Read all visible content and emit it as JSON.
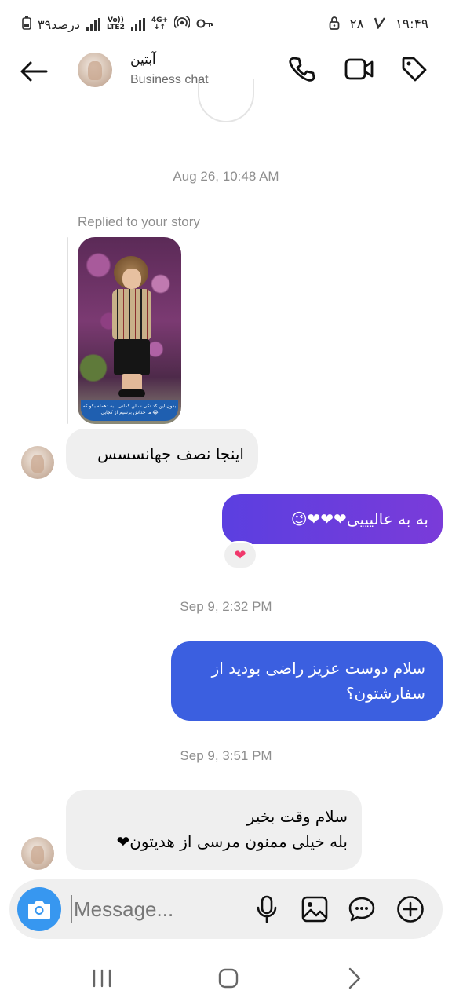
{
  "status_bar": {
    "time": "۱۹:۴۹",
    "battery_text": "۳۹درصد",
    "signal_icons": [
      "volte-icon",
      "4g-icon",
      "hotspot-icon",
      "vpn-key-icon"
    ],
    "right_number": "۲۸",
    "volte_label": "Vo)) LTE2",
    "net_label": "4G+"
  },
  "header": {
    "title": "آبتین",
    "subtitle": "Business chat",
    "icons": [
      "back-arrow-icon",
      "phone-icon",
      "video-camera-icon",
      "tag-icon"
    ]
  },
  "messages": {
    "timestamp_1": "Aug 26, 10:48 AM",
    "replied_label": "Replied to your story",
    "story_caption": "بدون این کد تکی سالن کمانی . به دهمله بکو که ما خداش برسیم از کجایی 😂",
    "reply_text": "اینجا نصف جهانسسس",
    "sent_1": "به به عالیییی❤❤❤😉",
    "reaction": "❤",
    "timestamp_2": "Sep 9, 2:32 PM",
    "sent_2_line1": "سلام دوست عزیز راضی بودید از",
    "sent_2_line2": "سفارشتون؟",
    "timestamp_3": "Sep 9, 3:51 PM",
    "received_2_line1": "سلام وقت بخیر",
    "received_2_line2": "بله خیلی ممنون مرسی از هدیتون❤"
  },
  "composer": {
    "placeholder": "Message...",
    "icons": [
      "camera-icon",
      "microphone-icon",
      "gallery-icon",
      "sticker-icon",
      "plus-icon"
    ]
  },
  "colors": {
    "sent_1_gradient": [
      "#5b3fe0",
      "#7a3bd9"
    ],
    "sent_2": "#3b5fe0",
    "received_bg": "#efefef",
    "camera_button": "#3797f0",
    "heart": "#f0386b"
  }
}
